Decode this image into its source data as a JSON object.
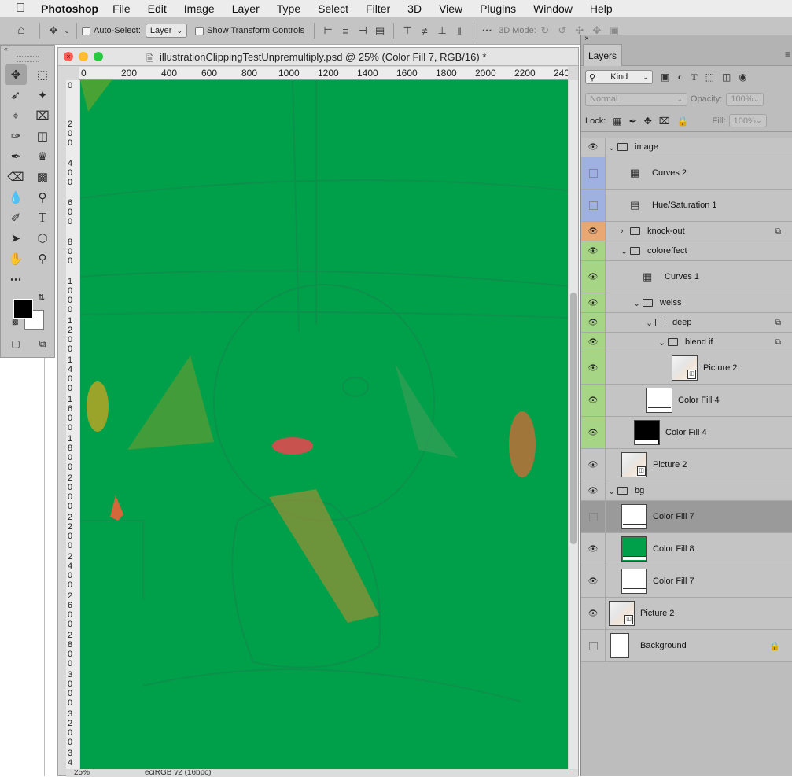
{
  "menubar": {
    "app_name": "Photoshop",
    "items": [
      "File",
      "Edit",
      "Image",
      "Layer",
      "Type",
      "Select",
      "Filter",
      "3D",
      "View",
      "Plugins",
      "Window",
      "Help"
    ]
  },
  "options_bar": {
    "auto_select_label": "Auto-Select:",
    "auto_select_value": "Layer",
    "show_transform_label": "Show Transform Controls",
    "mode_label": "3D Mode:"
  },
  "document": {
    "title": "illustrationClippingTestUnpremultiply.psd @ 25% (Color Fill 7, RGB/16) *",
    "ruler_top": [
      "0",
      "200",
      "400",
      "600",
      "800",
      "1000",
      "1200",
      "1400",
      "1600",
      "1800",
      "2000",
      "2200",
      "240"
    ],
    "ruler_left": [
      "0",
      "200",
      "400",
      "600",
      "800",
      "1000",
      "1200",
      "1400",
      "1600",
      "1800",
      "2000",
      "2200",
      "2400",
      "2600",
      "2800",
      "3000",
      "3200",
      "34"
    ],
    "zoom": "25%",
    "color_profile": "eciRGB v2 (16bpc)",
    "canvas_color": "#00a04b"
  },
  "layers_panel": {
    "tab_label": "Layers",
    "filter_kind": "Kind",
    "blend_mode": "Normal",
    "opacity_label": "Opacity:",
    "opacity_value": "100%",
    "lock_label": "Lock:",
    "fill_label": "Fill:",
    "fill_value": "100%",
    "layers": [
      {
        "name": "image",
        "type": "group",
        "expanded": true,
        "visible": true,
        "indent": 0,
        "height": 25
      },
      {
        "name": "Curves 2",
        "type": "curves",
        "visible": false,
        "color_label": "#9fb1e0",
        "indent": 1,
        "height": 41
      },
      {
        "name": "Hue/Saturation 1",
        "type": "huesat",
        "visible": false,
        "color_label": "#9fb1e0",
        "indent": 1,
        "height": 41
      },
      {
        "name": "knock-out",
        "type": "group",
        "expanded": false,
        "visible": true,
        "color_label": "#e9a774",
        "indent": 1,
        "height": 25,
        "linked": true
      },
      {
        "name": "coloreffect",
        "type": "group",
        "expanded": true,
        "visible": true,
        "color_label": "#a6d586",
        "indent": 1,
        "height": 25
      },
      {
        "name": "Curves 1",
        "type": "curves",
        "visible": true,
        "color_label": "#a6d586",
        "indent": 2,
        "height": 41
      },
      {
        "name": "weiss",
        "type": "group",
        "expanded": true,
        "visible": true,
        "color_label": "#a6d586",
        "indent": 2,
        "height": 25
      },
      {
        "name": "deep",
        "type": "group",
        "expanded": true,
        "visible": true,
        "color_label": "#a6d586",
        "indent": 3,
        "height": 25,
        "linked": true
      },
      {
        "name": "blend if",
        "type": "group",
        "expanded": true,
        "visible": true,
        "color_label": "#a6d586",
        "indent": 4,
        "height": 25,
        "linked": true
      },
      {
        "name": "Picture 2",
        "type": "smart",
        "visible": true,
        "color_label": "#a6d586",
        "indent": 5,
        "height": 41
      },
      {
        "name": "Color Fill 4",
        "type": "fill",
        "fill": "#ffffff",
        "visible": true,
        "color_label": "#a6d586",
        "indent": 3,
        "height": 41
      },
      {
        "name": "Color Fill 4",
        "type": "fill",
        "fill": "#000000",
        "visible": true,
        "color_label": "#a6d586",
        "indent": 2,
        "height": 41
      },
      {
        "name": "Picture 2",
        "type": "smart",
        "visible": true,
        "indent": 1,
        "height": 41
      },
      {
        "name": "bg",
        "type": "group",
        "expanded": true,
        "visible": true,
        "indent": 0,
        "height": 25
      },
      {
        "name": "Color Fill 7",
        "type": "fill",
        "fill": "#ffffff",
        "visible": false,
        "selected": true,
        "indent": 1,
        "height": 41
      },
      {
        "name": "Color Fill 8",
        "type": "fill",
        "fill": "#00a04b",
        "visible": true,
        "indent": 1,
        "height": 41
      },
      {
        "name": "Color Fill 7",
        "type": "fill",
        "fill": "#ffffff",
        "visible": true,
        "indent": 1,
        "height": 41
      },
      {
        "name": "Picture 2",
        "type": "smart",
        "visible": true,
        "indent": 0,
        "height": 41
      },
      {
        "name": "Background",
        "type": "bg",
        "visible": false,
        "locked": true,
        "indent": 0,
        "height": 41
      }
    ]
  }
}
